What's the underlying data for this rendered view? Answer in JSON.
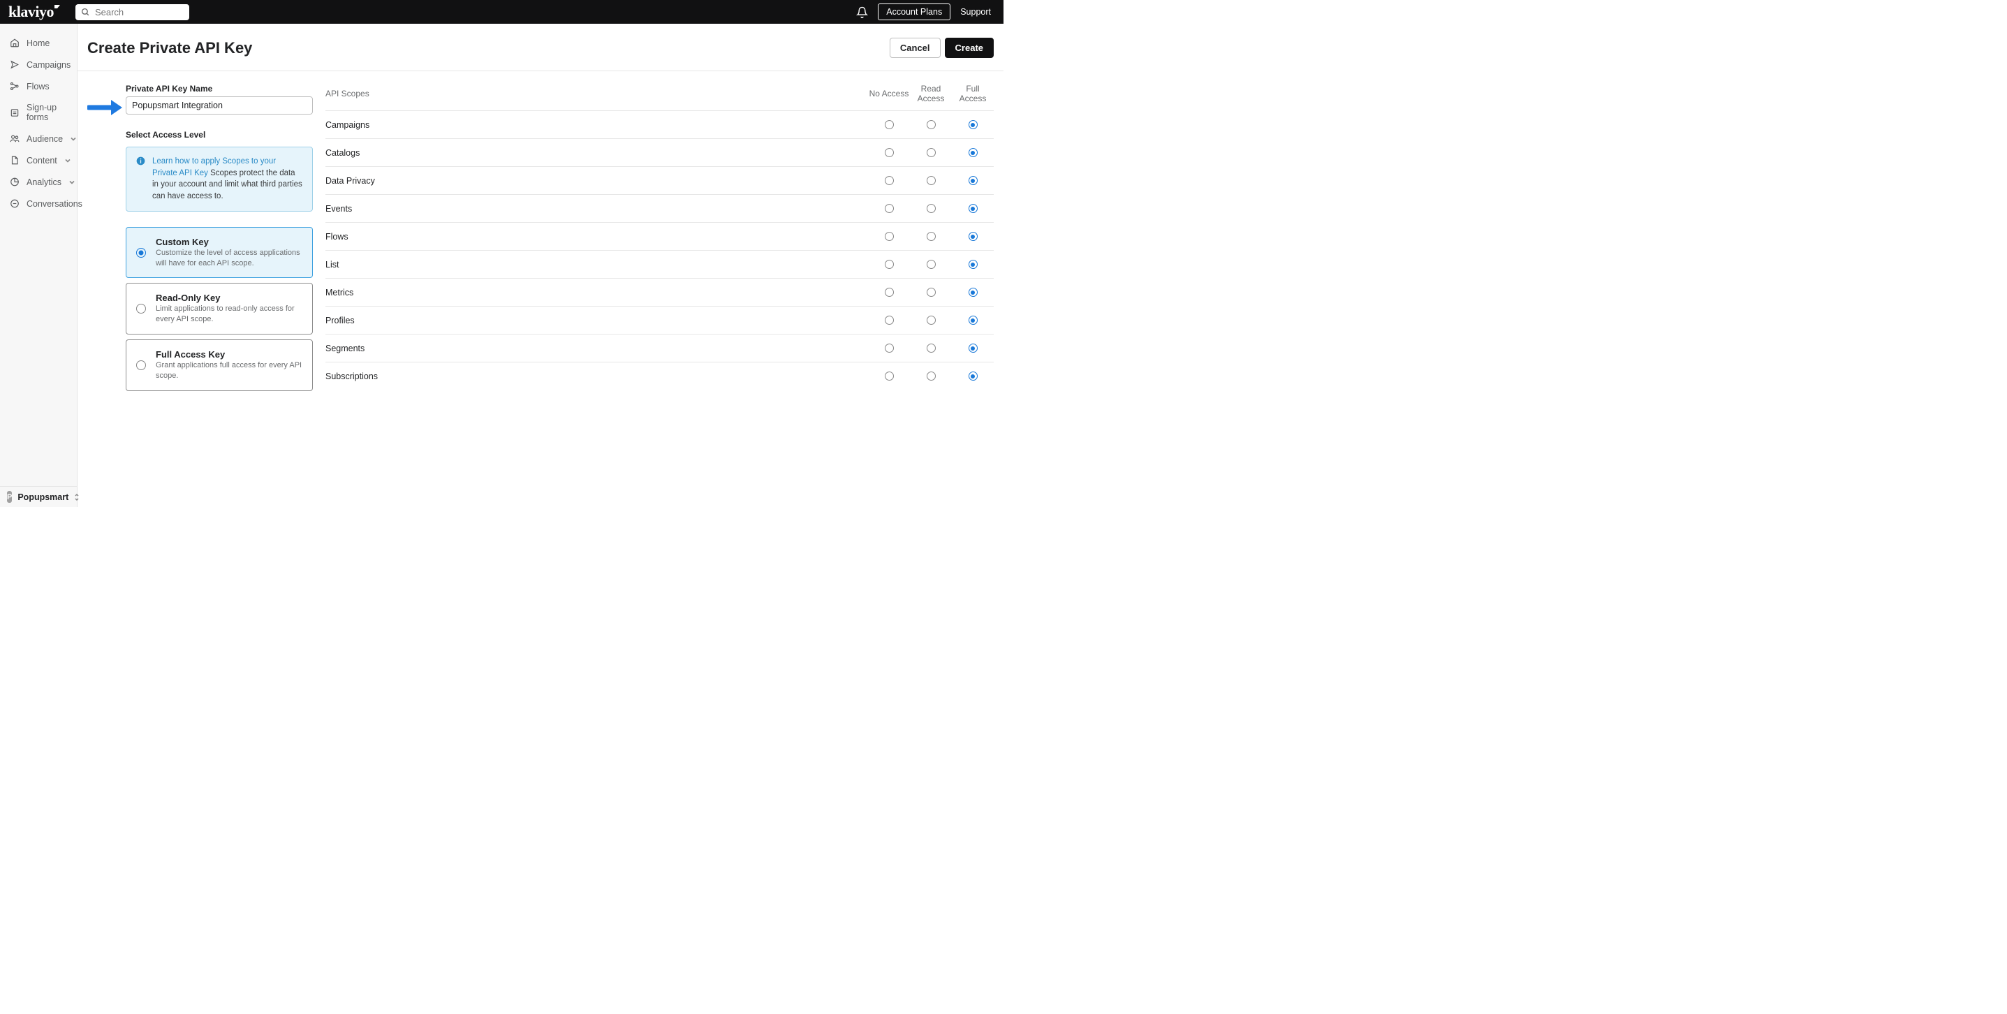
{
  "brand": "klaviyo",
  "search": {
    "placeholder": "Search"
  },
  "topbar": {
    "account_plans": "Account Plans",
    "support": "Support"
  },
  "sidebar": {
    "items": [
      {
        "label": "Home",
        "icon": "home"
      },
      {
        "label": "Campaigns",
        "icon": "send"
      },
      {
        "label": "Flows",
        "icon": "flow"
      },
      {
        "label": "Sign-up forms",
        "icon": "form"
      },
      {
        "label": "Audience",
        "icon": "people",
        "expandable": true
      },
      {
        "label": "Content",
        "icon": "doc",
        "expandable": true
      },
      {
        "label": "Analytics",
        "icon": "chart",
        "expandable": true
      },
      {
        "label": "Conversations",
        "icon": "chat"
      }
    ],
    "org": {
      "badge": "P",
      "name": "Popupsmart"
    }
  },
  "page": {
    "title": "Create Private API Key",
    "cancel": "Cancel",
    "create": "Create"
  },
  "form": {
    "name_label": "Private API Key Name",
    "name_value": "Popupsmart Integration",
    "access_label": "Select Access Level",
    "info_link": "Learn how to apply Scopes to your Private API Key",
    "info_text": " Scopes protect the data in your account and limit what third parties can have access to.",
    "levels": [
      {
        "title": "Custom Key",
        "desc": "Customize the level of access applications will have for each API scope.",
        "selected": true
      },
      {
        "title": "Read-Only Key",
        "desc": "Limit applications to read-only access for every API scope.",
        "selected": false
      },
      {
        "title": "Full Access Key",
        "desc": "Grant applications full access for every API scope.",
        "selected": false
      }
    ]
  },
  "scopes": {
    "headers": [
      "API Scopes",
      "No Access",
      "Read Access",
      "Full Access"
    ],
    "rows": [
      {
        "name": "Campaigns",
        "value": 2
      },
      {
        "name": "Catalogs",
        "value": 2
      },
      {
        "name": "Data Privacy",
        "value": 2
      },
      {
        "name": "Events",
        "value": 2
      },
      {
        "name": "Flows",
        "value": 2
      },
      {
        "name": "List",
        "value": 2
      },
      {
        "name": "Metrics",
        "value": 2
      },
      {
        "name": "Profiles",
        "value": 2
      },
      {
        "name": "Segments",
        "value": 2
      },
      {
        "name": "Subscriptions",
        "value": 2
      }
    ]
  }
}
